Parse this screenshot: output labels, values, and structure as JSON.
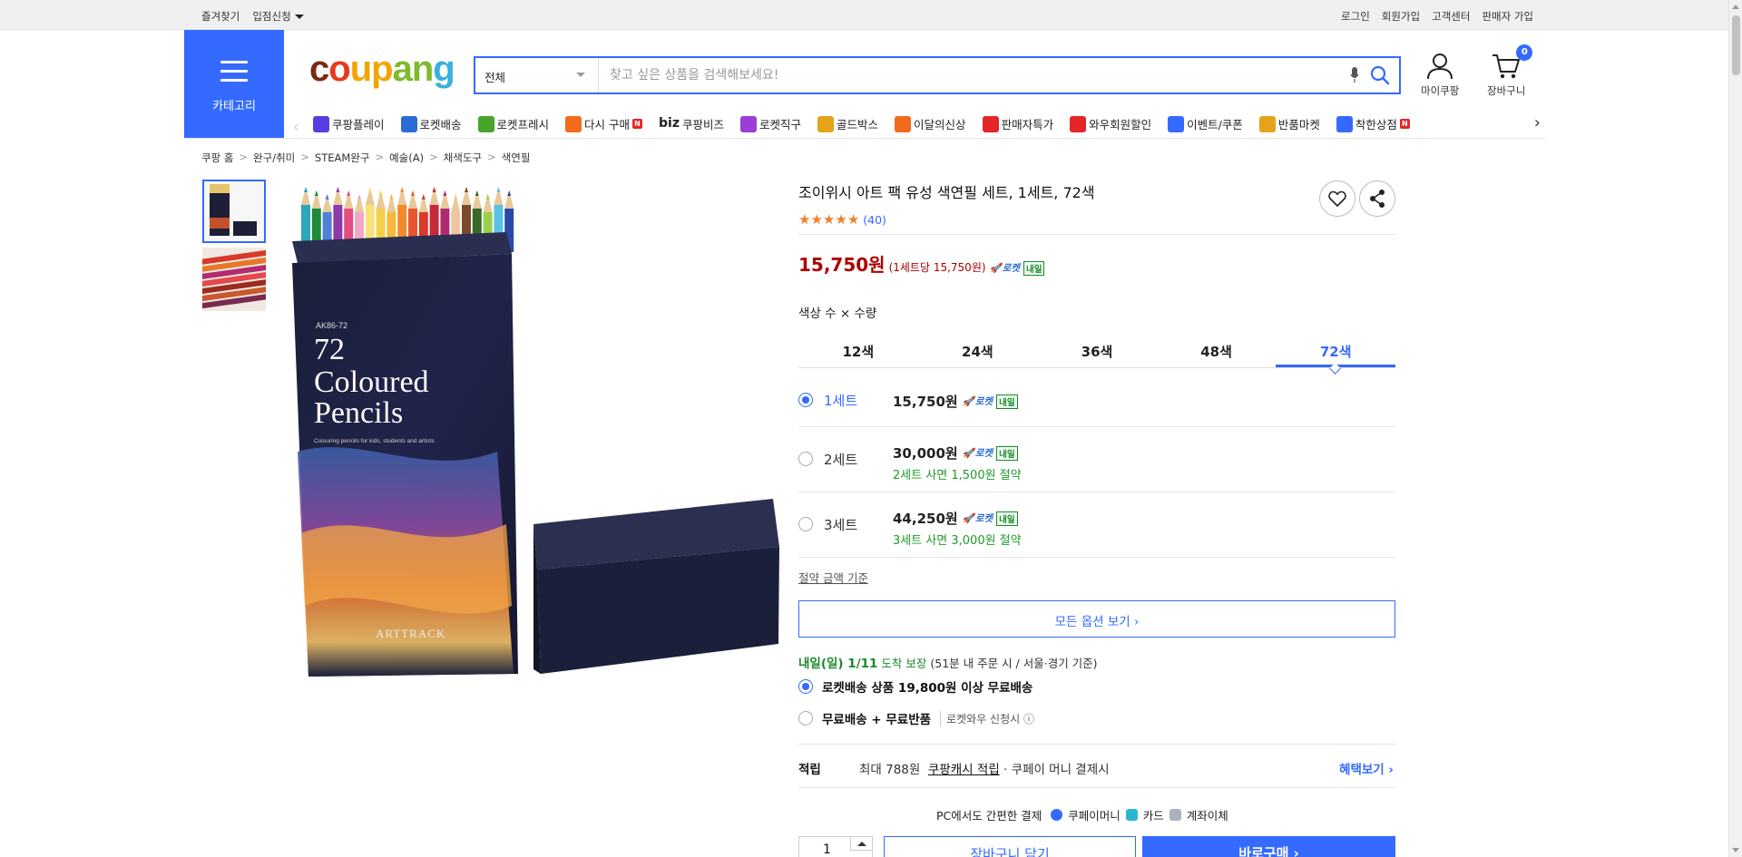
{
  "topbar": {
    "left": [
      "즐겨찾기",
      "입점신청"
    ],
    "right": [
      "로그인",
      "회원가입",
      "고객센터",
      "판매자 가입"
    ]
  },
  "header": {
    "category_label": "카테고리",
    "logo": {
      "c": "c",
      "o": "o",
      "u": "u",
      "p": "p",
      "a": "a",
      "n": "n",
      "g": "g"
    },
    "search": {
      "category": "전체",
      "placeholder": "찾고 싶은 상품을 검색해보세요!"
    },
    "mypage_label": "마이쿠팡",
    "cart_label": "장바구니",
    "cart_count": "0"
  },
  "nav": {
    "items": [
      {
        "label": "쿠팡플레이",
        "icon": "play-icon",
        "color": "#5a3de0"
      },
      {
        "label": "로켓배송",
        "icon": "rocket-icon",
        "color": "#2a6cd4"
      },
      {
        "label": "로켓프레시",
        "icon": "rocket-fresh-icon",
        "color": "#46a52a"
      },
      {
        "label": "다시 구매",
        "icon": "rebuy-icon",
        "color": "#f26b1d",
        "new": "N"
      },
      {
        "label": "쿠팡비즈",
        "prefix": "biz",
        "icon": "biz-icon",
        "color": "#333333"
      },
      {
        "label": "로켓직구",
        "icon": "globe-icon",
        "color": "#9b3dd8"
      },
      {
        "label": "골드박스",
        "icon": "goldbox-icon",
        "color": "#e6a21a"
      },
      {
        "label": "이달의신상",
        "icon": "new-bag-icon",
        "color": "#f26b1d"
      },
      {
        "label": "판매자특가",
        "icon": "percent-icon",
        "color": "#e52528"
      },
      {
        "label": "와우회원할인",
        "icon": "wow-icon",
        "color": "#e52528"
      },
      {
        "label": "이벤트/쿠폰",
        "icon": "coupon-icon",
        "color": "#346aff"
      },
      {
        "label": "반품마켓",
        "icon": "market-icon",
        "color": "#e6a21a"
      },
      {
        "label": "착한상점",
        "icon": "store-icon",
        "color": "#346aff",
        "new": "N"
      }
    ]
  },
  "breadcrumb": [
    "쿠팡 홈",
    "완구/취미",
    "STEAM완구",
    "예술(A)",
    "채색도구",
    "색연필"
  ],
  "product": {
    "title": "조이위시 아트 팩 유성 색연필 세트, 1세트, 72색",
    "rating": 5,
    "review_count": "(40)",
    "price": "15,750원",
    "unit_price": "(1세트당 15,750원)",
    "rocket_label": "로켓",
    "tomorrow_label": "내일",
    "image_text": {
      "code": "AK86-72",
      "number": "72",
      "line1": "Coloured",
      "line2": "Pencils",
      "sub": "Colouring pencils for kids, students and artists",
      "brand": "ARTTRACK"
    },
    "option_label": "색상 수 × 수량",
    "color_tabs": [
      "12색",
      "24색",
      "36색",
      "48색",
      "72색"
    ],
    "active_tab": 4,
    "quantity_options": [
      {
        "name": "1세트",
        "price": "15,750원",
        "saving": "",
        "selected": true
      },
      {
        "name": "2세트",
        "price": "30,000원",
        "saving": "2세트 사면 1,500원 절약",
        "selected": false
      },
      {
        "name": "3세트",
        "price": "44,250원",
        "saving": "3세트 사면 3,000원 절약",
        "selected": false
      }
    ],
    "saving_basis": "절약 금액 기준",
    "all_options": "모든 옵션 보기 ›",
    "delivery": {
      "date": "내일(일) 1/11",
      "guarantee": "도착 보장",
      "note": "(51분 내 주문 시 / 서울·경기 기준)"
    },
    "shipping": [
      {
        "label": "로켓배송 상품 19,800원 이상 무료배송",
        "sub": "",
        "selected": true
      },
      {
        "label": "무료배송 + 무료반품",
        "sub": "로켓와우 신청시 ⓘ",
        "selected": false
      }
    ],
    "reward": {
      "label": "적립",
      "prefix": "최대 788원",
      "link": "쿠팡캐시 적립",
      "suffix": "· 쿠페이 머니 결제시",
      "more": "혜택보기 ›"
    },
    "pc_pay": {
      "label": "PC에서도 간편한 결제",
      "methods": [
        "쿠페이머니",
        "카드",
        "계좌이체"
      ]
    },
    "quantity": "1",
    "cart_button": "장바구니 담기",
    "buy_button": "바로구매 ›"
  },
  "colors": {
    "accent": "#346aff",
    "price_red": "#ae0000",
    "green": "#1a8a2a",
    "star": "#f2802a"
  }
}
